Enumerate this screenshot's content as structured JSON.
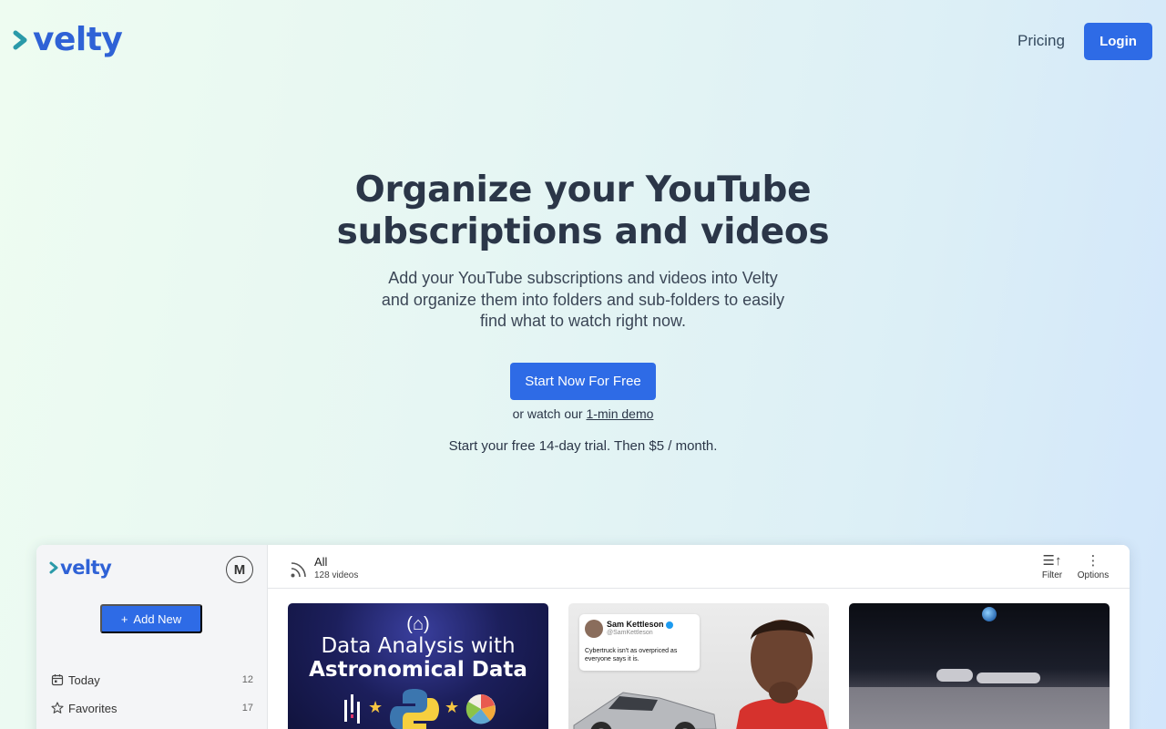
{
  "brand": {
    "name": "velty",
    "accent": "#2f62d6",
    "chevron_color": "#2a9aa9"
  },
  "nav": {
    "pricing": "Pricing",
    "login": "Login"
  },
  "hero": {
    "title": "Organize your YouTube subscriptions and videos",
    "subtitle": "Add your YouTube subscriptions and videos into Velty and organize them into folders and sub-folders to easily find what to watch right now.",
    "cta": "Start Now For Free",
    "demo_prefix": "or watch our ",
    "demo_link": "1-min demo",
    "trial": "Start your free 14-day trial. Then $5 / month."
  },
  "app_preview": {
    "avatar_initial": "M",
    "add_new": "Add New",
    "sidebar": [
      {
        "label": "Today",
        "count": "12",
        "icon": "calendar-icon"
      },
      {
        "label": "Favorites",
        "count": "17",
        "icon": "star-icon"
      }
    ],
    "feed": {
      "title": "All",
      "count": "128 videos"
    },
    "toolbar": {
      "filter": "Filter",
      "options": "Options"
    },
    "videos": [
      {
        "brand": "(⌂)",
        "line1": "Data Analysis with",
        "line2": "Astronomical Data"
      },
      {
        "tweet_name": "Sam Kettleson",
        "tweet_handle": "@SamKettleson",
        "tweet_text": "Cybertruck isn't as overpriced as everyone says it is."
      },
      {
        "scene": "moon-base"
      }
    ]
  }
}
